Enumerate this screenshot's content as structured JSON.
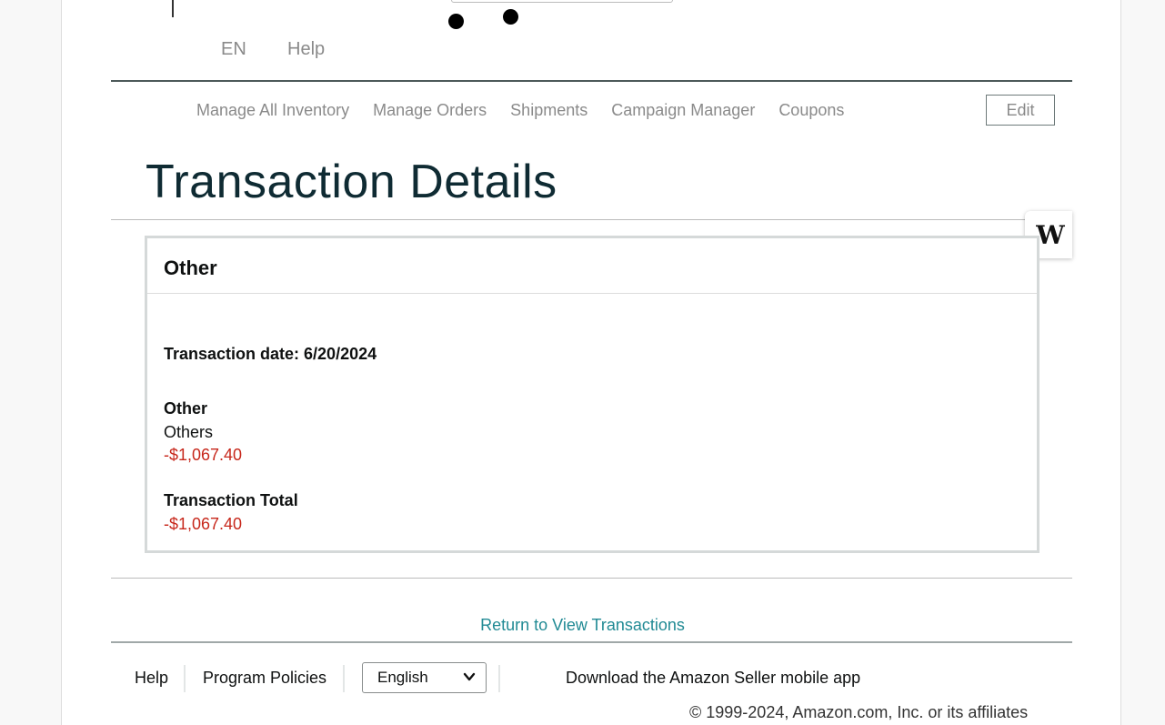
{
  "header": {
    "lang_label": "EN",
    "help_label": "Help"
  },
  "nav": {
    "items": [
      "Manage All Inventory",
      "Manage Orders",
      "Shipments",
      "Campaign Manager",
      "Coupons"
    ],
    "edit_label": "Edit"
  },
  "page": {
    "title": "Transaction Details"
  },
  "widget": {
    "badge_icon": "w-logo-icon"
  },
  "card": {
    "title": "Other",
    "transaction_date": "Transaction date: 6/20/2024",
    "category_label": "Other",
    "category_sub": "Others",
    "category_amount": "-$1,067.40",
    "total_label": "Transaction Total",
    "total_amount": "-$1,067.40"
  },
  "colors": {
    "negative_amount": "#c7271b",
    "link": "#218a94",
    "title": "#0f2b33"
  },
  "return_link": "Return to View Transactions",
  "footer": {
    "help": "Help",
    "policies": "Program Policies",
    "language_selected": "English",
    "mobile_app": "Download the Amazon Seller mobile app",
    "copyright": "© 1999-2024, Amazon.com, Inc. or its affiliates"
  }
}
